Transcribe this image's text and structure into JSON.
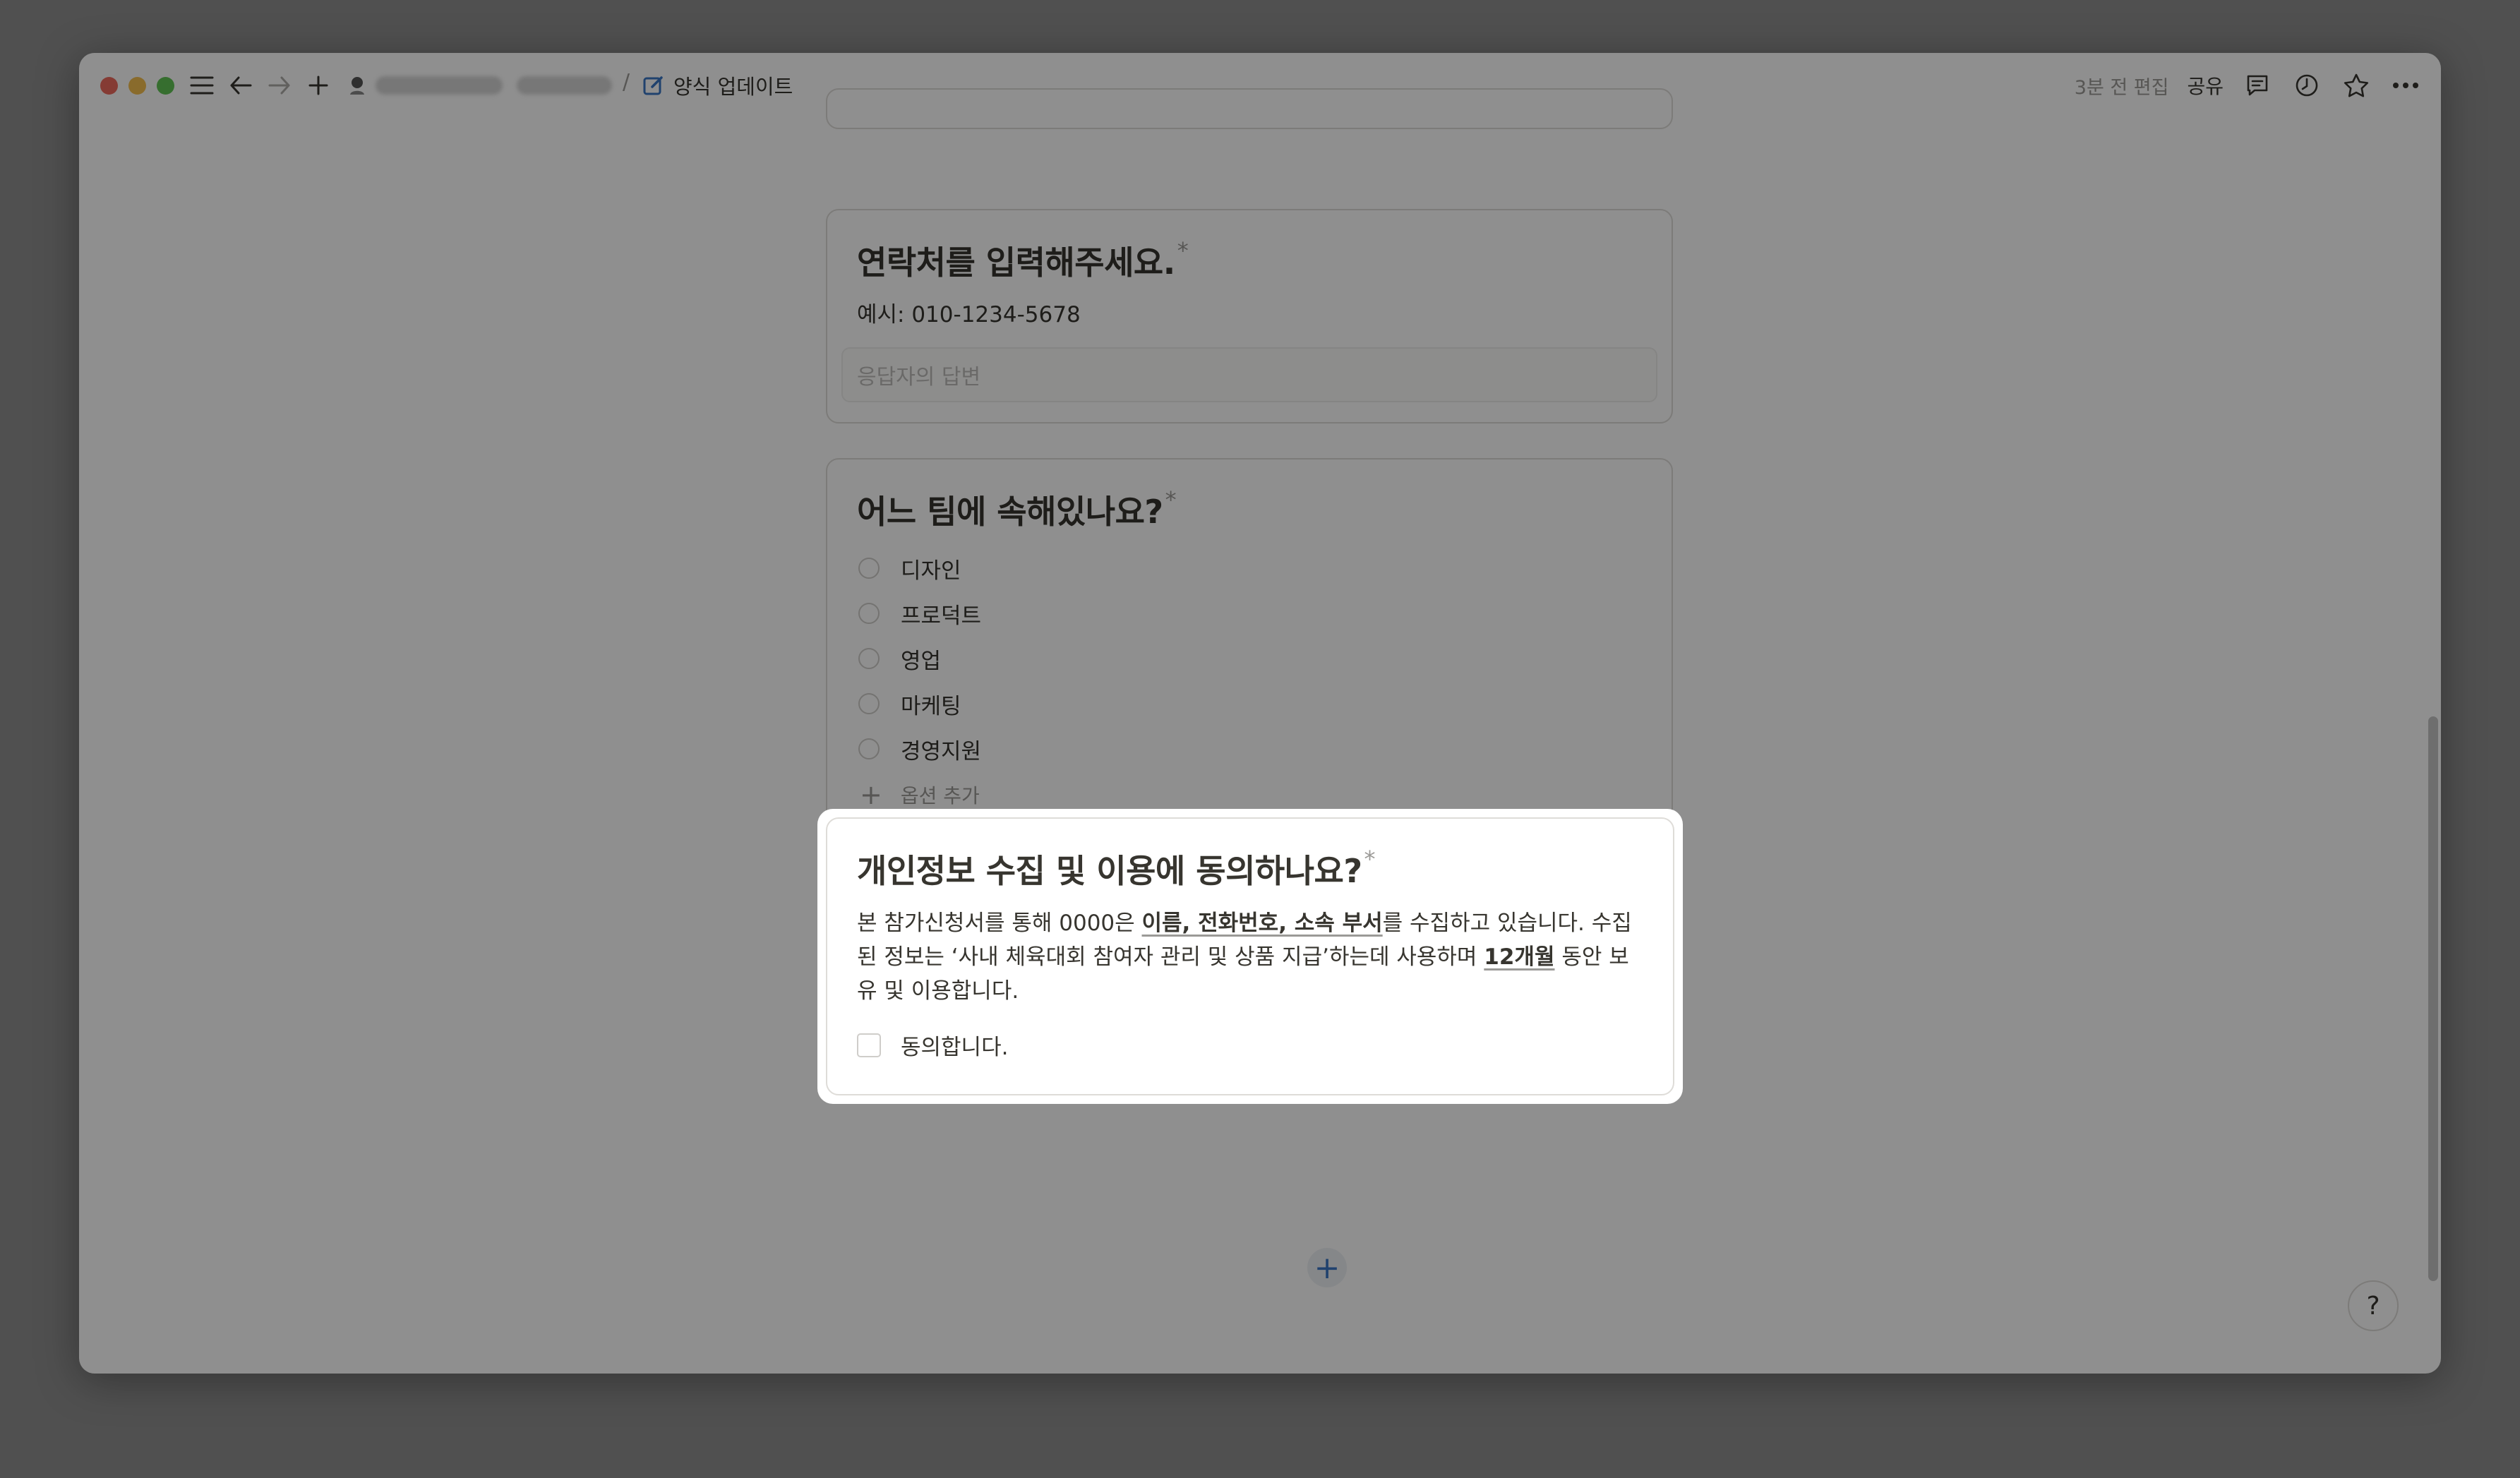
{
  "topbar": {
    "page_title": "양식 업데이트",
    "breadcrumb_separator": "/",
    "edited": "3분 전 편집",
    "share": "공유"
  },
  "questions": [
    {
      "title": "연락처를 입력해주세요.",
      "required_mark": "*",
      "description": "예시: 010-1234-5678",
      "answer_placeholder": "응답자의 답변"
    },
    {
      "title": "어느 팀에 속해있나요?",
      "required_mark": "*",
      "options": [
        "디자인",
        "프로덕트",
        "영업",
        "마케팅",
        "경영지원"
      ],
      "add_option": "옵션 추가"
    },
    {
      "title": "개인정보 수집 및 이용에 동의하나요?",
      "required_mark": "*",
      "description_parts": {
        "p1": "본 참가신청서를 통해 0000은 ",
        "u1": "이름, 전화번호, 소속 부서",
        "p2": "를 수집하고 있습니다. 수집된 정보는 ‘사내 체육대회 참여자 관리 및 상품 지급’하는데 사용하며 ",
        "u2": "12개월",
        "p3": " 동안 보유 및 이용합니다."
      },
      "checkbox_label": "동의합니다.",
      "checked": false
    }
  ],
  "add_block": "+",
  "help": "?",
  "colors": {
    "background": "#8f8f8f",
    "text": "#37352f",
    "muted": "#9b9a97",
    "accent": "#3a76c4"
  }
}
